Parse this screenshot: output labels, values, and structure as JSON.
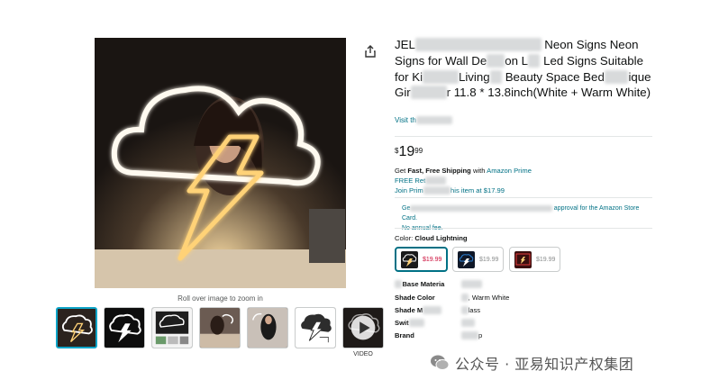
{
  "product": {
    "title_parts": [
      "JEL",
      "Neon Signs for Wall De",
      "on L",
      "Led Signs Suitable for Ki",
      "Living",
      "Beauty Space Bed",
      "ique Gir",
      "r 11.8 * 13.8inch(White + Warm White)"
    ],
    "visit_store": "Visit th",
    "price": {
      "currency": "$",
      "whole": "19",
      "fraction": "99"
    },
    "zoom_hint": "Roll over image to zoom in",
    "video_label": "VIDEO"
  },
  "shipping": {
    "prefix": "Get ",
    "fast_free": "Fast, Free Shipping",
    "with": " with ",
    "prime": "Amazon Prime",
    "free_returns": "FREE Ret",
    "join_prime": "Join Prim",
    "join_suffix": "his item at $17.99"
  },
  "card_offer": {
    "start": "Ge",
    "end": "approval for the Amazon Store Card.",
    "line2": "No annual fee."
  },
  "color": {
    "label": "Color: ",
    "selected": "Cloud Lightning",
    "swatches": [
      {
        "price": "$19.99",
        "color": "#f4f4f4"
      },
      {
        "price": "$19.99",
        "color": "#2a7fd4"
      },
      {
        "price": "$19.99",
        "color": "#e23b3b"
      }
    ]
  },
  "specs": [
    {
      "key": "Base Materia",
      "value": "Plastic"
    },
    {
      "key": "Shade Color",
      "value": ", Warm White"
    },
    {
      "key": "Shade M",
      "value": "lass"
    },
    {
      "key": "Swit",
      "value": ""
    },
    {
      "key": "Brand",
      "value": "p"
    }
  ],
  "watermark": {
    "text": "公众号 · 亚易知识产权集团"
  },
  "colors": {
    "link": "#007185",
    "accent": "#0ea5c8",
    "price_red": "#cc0c39"
  },
  "icons": [
    "share-icon",
    "play-icon",
    "wechat-icon",
    "cloud-lightning-neon-icon"
  ]
}
